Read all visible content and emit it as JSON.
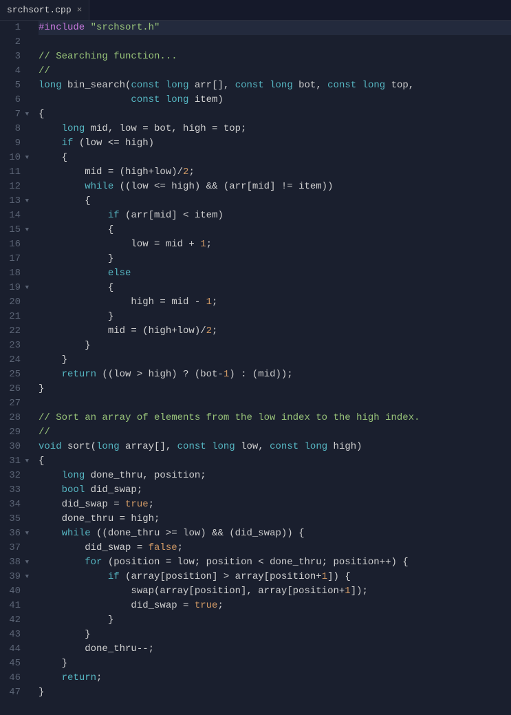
{
  "tab": {
    "filename": "srchsort.cpp",
    "close": "×"
  },
  "gutter": [
    {
      "n": "1"
    },
    {
      "n": "2"
    },
    {
      "n": "3"
    },
    {
      "n": "4"
    },
    {
      "n": "5"
    },
    {
      "n": "6"
    },
    {
      "n": "7",
      "fold": true
    },
    {
      "n": "8"
    },
    {
      "n": "9"
    },
    {
      "n": "10",
      "fold": true
    },
    {
      "n": "11"
    },
    {
      "n": "12"
    },
    {
      "n": "13",
      "fold": true
    },
    {
      "n": "14"
    },
    {
      "n": "15",
      "fold": true
    },
    {
      "n": "16"
    },
    {
      "n": "17"
    },
    {
      "n": "18"
    },
    {
      "n": "19",
      "fold": true
    },
    {
      "n": "20"
    },
    {
      "n": "21"
    },
    {
      "n": "22"
    },
    {
      "n": "23"
    },
    {
      "n": "24"
    },
    {
      "n": "25"
    },
    {
      "n": "26"
    },
    {
      "n": "27"
    },
    {
      "n": "28"
    },
    {
      "n": "29"
    },
    {
      "n": "30"
    },
    {
      "n": "31",
      "fold": true
    },
    {
      "n": "32"
    },
    {
      "n": "33"
    },
    {
      "n": "34"
    },
    {
      "n": "35"
    },
    {
      "n": "36",
      "fold": true
    },
    {
      "n": "37"
    },
    {
      "n": "38",
      "fold": true
    },
    {
      "n": "39",
      "fold": true
    },
    {
      "n": "40"
    },
    {
      "n": "41"
    },
    {
      "n": "42"
    },
    {
      "n": "43"
    },
    {
      "n": "44"
    },
    {
      "n": "45"
    },
    {
      "n": "46"
    },
    {
      "n": "47"
    }
  ],
  "code": {
    "l1": {
      "a": "#include",
      "b": " ",
      "c": "\"srchsort.h\""
    },
    "l2": "",
    "l3": "// Searching function...",
    "l4": "//",
    "l5": {
      "a": "long",
      "b": " bin_search(",
      "c": "const",
      "d": " ",
      "e": "long",
      "f": " arr[], ",
      "g": "const",
      "h": " ",
      "i": "long",
      "j": " bot, ",
      "k": "const",
      "l": " ",
      "m": "long",
      "n": " top,"
    },
    "l6": {
      "a": "                ",
      "b": "const",
      "c": " ",
      "d": "long",
      "e": " item)"
    },
    "l7": "{",
    "l8": {
      "a": "    ",
      "b": "long",
      "c": " mid, low = bot, high = top;"
    },
    "l9": {
      "a": "    ",
      "b": "if",
      "c": " (low <= high)"
    },
    "l10": "    {",
    "l11": {
      "a": "        mid = (high+low)/",
      "b": "2",
      "c": ";"
    },
    "l12": {
      "a": "        ",
      "b": "while",
      "c": " ((low <= high) && (arr[mid] != item))"
    },
    "l13": "        {",
    "l14": {
      "a": "            ",
      "b": "if",
      "c": " (arr[mid] < item)"
    },
    "l15": "            {",
    "l16": {
      "a": "                low = mid + ",
      "b": "1",
      "c": ";"
    },
    "l17": "            }",
    "l18": {
      "a": "            ",
      "b": "else"
    },
    "l19": "            {",
    "l20": {
      "a": "                high = mid - ",
      "b": "1",
      "c": ";"
    },
    "l21": "            }",
    "l22": {
      "a": "            mid = (high+low)/",
      "b": "2",
      "c": ";"
    },
    "l23": "        }",
    "l24": "    }",
    "l25": {
      "a": "    ",
      "b": "return",
      "c": " ((low > high) ? (bot-",
      "d": "1",
      "e": ") : (mid));"
    },
    "l26": "}",
    "l27": "",
    "l28": "// Sort an array of elements from the low index to the high index.",
    "l29": "//",
    "l30": {
      "a": "void",
      "b": " sort(",
      "c": "long",
      "d": " array[], ",
      "e": "const",
      "f": " ",
      "g": "long",
      "h": " low, ",
      "i": "const",
      "j": " ",
      "k": "long",
      "l": " high)"
    },
    "l31": "{",
    "l32": {
      "a": "    ",
      "b": "long",
      "c": " done_thru, position;"
    },
    "l33": {
      "a": "    ",
      "b": "bool",
      "c": " did_swap;"
    },
    "l34": {
      "a": "    did_swap = ",
      "b": "true",
      "c": ";"
    },
    "l35": "    done_thru = high;",
    "l36": {
      "a": "    ",
      "b": "while",
      "c": " ((done_thru >= low) && (did_swap)) {"
    },
    "l37": {
      "a": "        did_swap = ",
      "b": "false",
      "c": ";"
    },
    "l38": {
      "a": "        ",
      "b": "for",
      "c": " (position = low; position < done_thru; position++) {"
    },
    "l39": {
      "a": "            ",
      "b": "if",
      "c": " (array[position] > array[position+",
      "d": "1",
      "e": "]) {"
    },
    "l40": {
      "a": "                swap(array[position], array[position+",
      "b": "1",
      "c": "]);"
    },
    "l41": {
      "a": "                did_swap = ",
      "b": "true",
      "c": ";"
    },
    "l42": "            }",
    "l43": "        }",
    "l44": "        done_thru--;",
    "l45": "    }",
    "l46": {
      "a": "    ",
      "b": "return",
      "c": ";"
    },
    "l47": "}"
  }
}
